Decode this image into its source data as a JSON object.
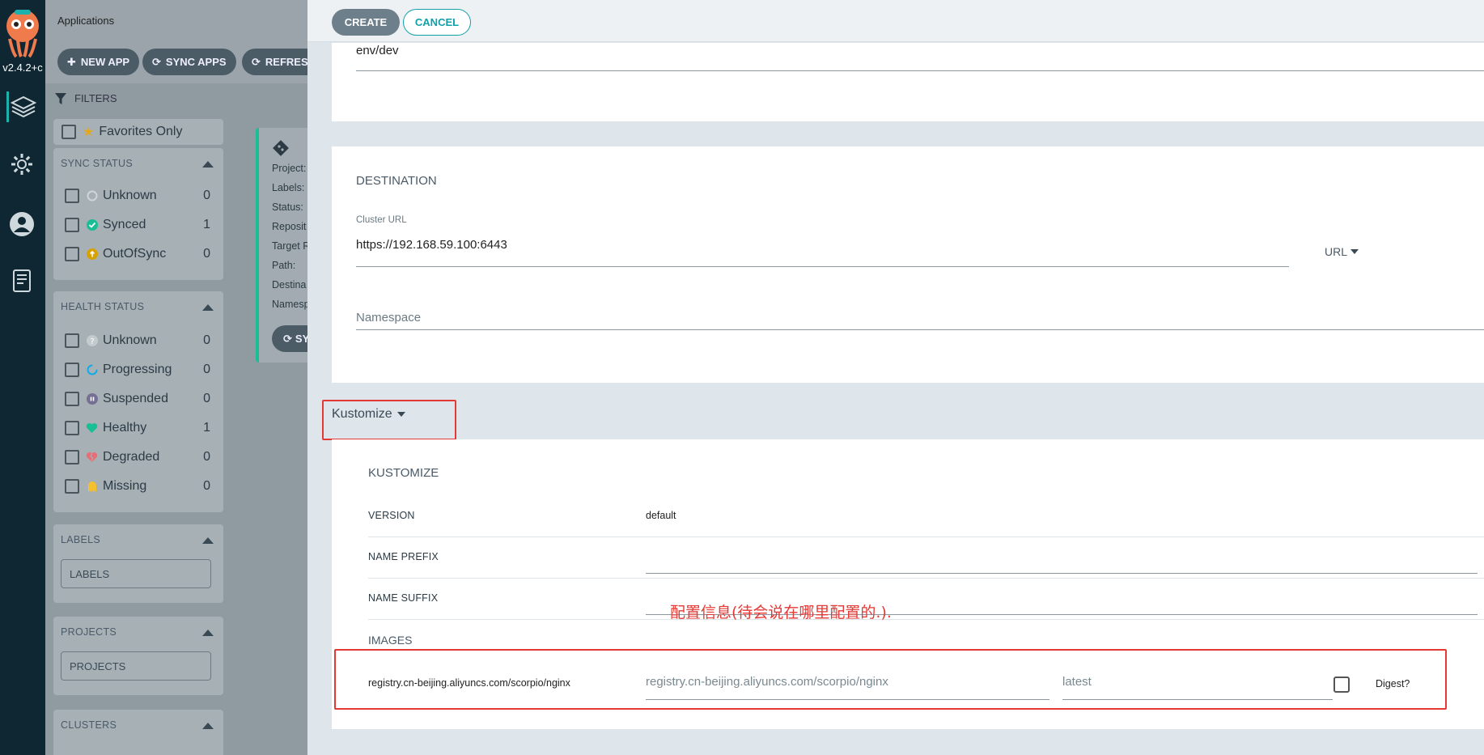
{
  "nav": {
    "version": "v2.4.2+c",
    "icons": [
      "argo-logo-icon",
      "layers-icon",
      "gear-icon",
      "user-icon",
      "docs-icon"
    ]
  },
  "apps": {
    "title": "Applications",
    "toolbar": {
      "new_app": "NEW APP",
      "sync_apps": "SYNC APPS",
      "refresh": "REFRESH"
    },
    "filters_label": "FILTERS",
    "favorites_label": "Favorites Only",
    "sync_status": {
      "title": "SYNC STATUS",
      "items": [
        {
          "label": "Unknown",
          "count": "0"
        },
        {
          "label": "Synced",
          "count": "1"
        },
        {
          "label": "OutOfSync",
          "count": "0"
        }
      ]
    },
    "health_status": {
      "title": "HEALTH STATUS",
      "items": [
        {
          "label": "Unknown",
          "count": "0"
        },
        {
          "label": "Progressing",
          "count": "0"
        },
        {
          "label": "Suspended",
          "count": "0"
        },
        {
          "label": "Healthy",
          "count": "1"
        },
        {
          "label": "Degraded",
          "count": "0"
        },
        {
          "label": "Missing",
          "count": "0"
        }
      ]
    },
    "labels": {
      "title": "LABELS",
      "placeholder": "LABELS"
    },
    "projects": {
      "title": "PROJECTS",
      "placeholder": "PROJECTS"
    },
    "clusters": {
      "title": "CLUSTERS"
    },
    "tile": {
      "lines": [
        "Project:",
        "Labels:",
        "Status:",
        "Reposit",
        "Target R",
        "Path:",
        "Destina",
        "Namesp"
      ],
      "sync_label": "SY"
    }
  },
  "panel": {
    "create_label": "CREATE",
    "cancel_label": "CANCEL",
    "path_value": "env/dev",
    "destination": {
      "title": "DESTINATION",
      "cluster_url_label": "Cluster URL",
      "cluster_url_value": "https://192.168.59.100:6443",
      "url_toggle": "URL",
      "namespace_placeholder": "Namespace"
    },
    "kustomize_toggle": "Kustomize",
    "kustomize": {
      "title": "KUSTOMIZE",
      "version_label": "VERSION",
      "version_value": "default",
      "name_prefix_label": "NAME PREFIX",
      "name_suffix_label": "NAME SUFFIX",
      "images_label": "IMAGES",
      "image_name": "registry.cn-beijing.aliyuncs.com/scorpio/nginx",
      "image_new_name_placeholder": "registry.cn-beijing.aliyuncs.com/scorpio/nginx",
      "image_tag_placeholder": "latest",
      "digest_label": "Digest?"
    },
    "annotation": "配置信息(待会说在哪里配置的.)."
  },
  "colors": {
    "accent": "#10a0a8",
    "annotation_red": "#e53935",
    "nav_bg": "#0f2733"
  }
}
